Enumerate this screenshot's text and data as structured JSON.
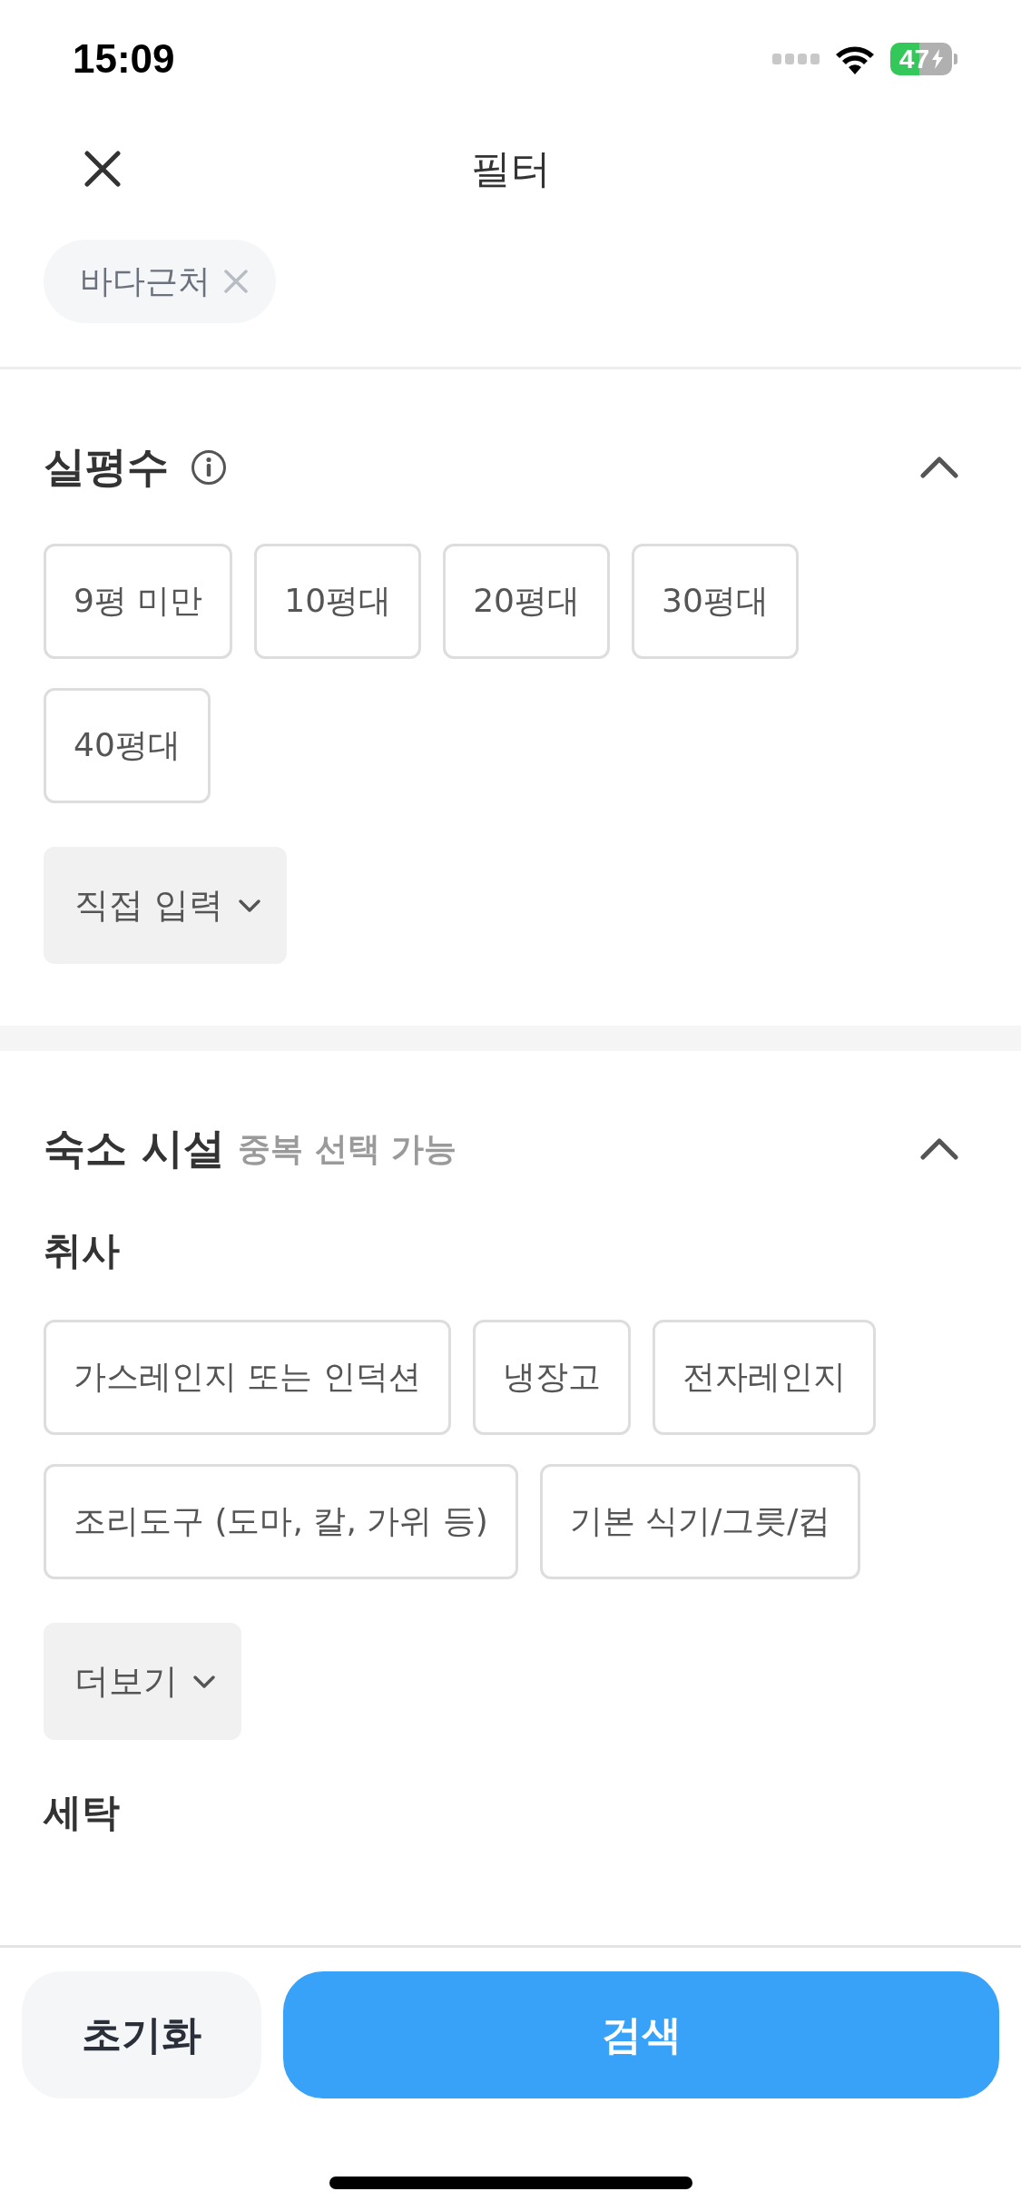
{
  "status_bar": {
    "time": "15:09",
    "battery": "47"
  },
  "header": {
    "title": "필터"
  },
  "applied_filters": [
    {
      "label": "바다근처"
    }
  ],
  "sections": [
    {
      "title": "실평수",
      "info": true,
      "expanded": true,
      "groups": [
        {
          "options": [
            {
              "label": "9평 미만",
              "selected": false
            },
            {
              "label": "10평대",
              "selected": false
            },
            {
              "label": "20평대",
              "selected": false
            },
            {
              "label": "30평대",
              "selected": false
            },
            {
              "label": "40평대",
              "selected": false
            }
          ],
          "more": "직접 입력"
        }
      ]
    },
    {
      "title": "숙소 시설",
      "subtitle": "중복 선택 가능",
      "expanded": true,
      "groups": [
        {
          "heading": "취사",
          "options": [
            {
              "label": "가스레인지 또는 인덕션",
              "selected": false
            },
            {
              "label": "냉장고",
              "selected": false
            },
            {
              "label": "전자레인지",
              "selected": false
            },
            {
              "label": "조리도구 (도마, 칼, 가위 등)",
              "selected": false
            },
            {
              "label": "기본 식기/그릇/컵",
              "selected": false
            }
          ],
          "more": "더보기"
        },
        {
          "heading": "세탁"
        }
      ]
    }
  ],
  "footer": {
    "reset": "초기화",
    "search": "검색"
  }
}
